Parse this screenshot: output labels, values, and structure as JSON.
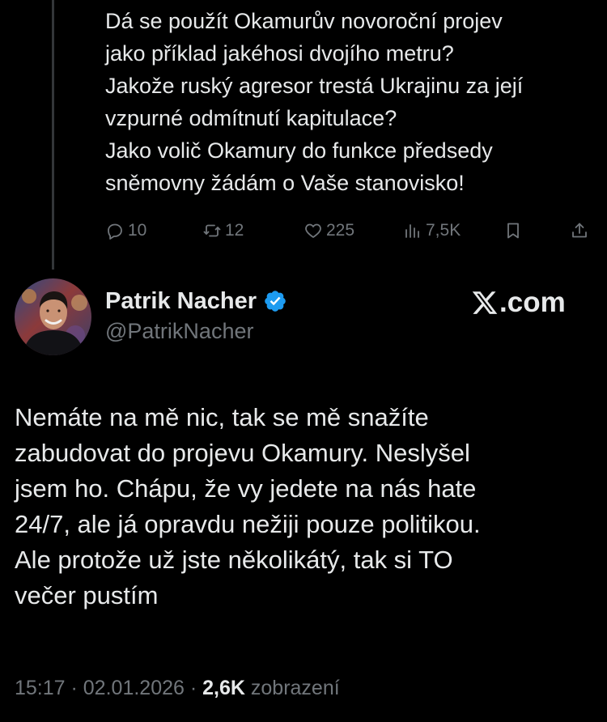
{
  "previous_tweet": {
    "lines": [
      "Dá se použít Okamurův novoroční projev",
      "jako příklad jakéhosi dvojího metru?",
      "Jakože ruský agresor trestá Ukrajinu za její",
      "vzpurné odmítnutí kapitulace?",
      "Jako volič Okamury do funkce předsedy",
      "sněmovny žádám o Vaše stanovisko!"
    ],
    "actions": {
      "replies": "10",
      "reposts": "12",
      "likes": "225",
      "views": "7,5K"
    }
  },
  "author": {
    "display_name": "Patrik Nacher",
    "handle": "@PatrikNacher",
    "verified": true
  },
  "watermark": {
    "text": ".com"
  },
  "tweet": {
    "lines": [
      "Nemáte na mě nic, tak se mě snažíte",
      "zabudovat do projevu Okamury. Neslyšel",
      "jsem ho. Chápu, že vy jedete na nás hate",
      "24/7, ale já opravdu nežiji pouze politikou.",
      "Ale protože už jste několikátý, tak si TO",
      "večer pustím"
    ],
    "time": "15:17",
    "separator": " · ",
    "date": "02.01.2026",
    "views_count": "2,6K",
    "views_label": " zobrazení"
  },
  "colors": {
    "background": "#000000",
    "text": "#e7e9ea",
    "muted": "#71767b",
    "verified_badge": "#1d9bf0",
    "thread_line": "#333639"
  }
}
